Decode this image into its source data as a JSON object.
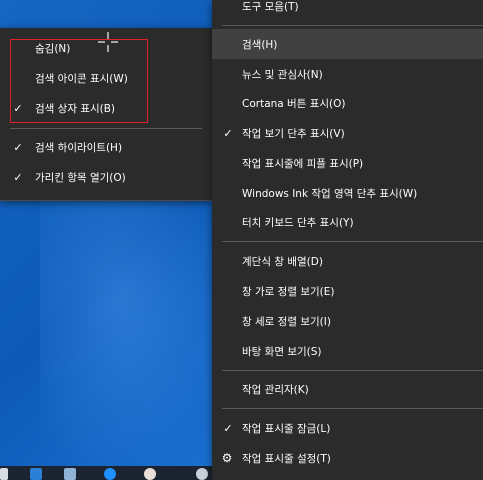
{
  "submenu": {
    "items": [
      {
        "label": "숨김(N)",
        "checked": false
      },
      {
        "label": "검색 아이콘 표시(W)",
        "checked": false
      },
      {
        "label": "검색 상자 표시(B)",
        "checked": true
      },
      {
        "label": "검색 하이라이트(H)",
        "checked": true
      },
      {
        "label": "가리킨 항목 열기(O)",
        "checked": true
      }
    ],
    "check_glyph": "✓"
  },
  "mainmenu": {
    "items": [
      {
        "label": "도구 모음(T)"
      },
      {
        "label": "검색(H)"
      },
      {
        "label": "뉴스 및 관심사(N)"
      },
      {
        "label": "Cortana 버튼 표시(O)"
      },
      {
        "label": "작업 보기 단추 표시(V)",
        "checked": true
      },
      {
        "label": "작업 표시줄에 피플 표시(P)"
      },
      {
        "label": "Windows Ink 작업 영역 단추 표시(W)"
      },
      {
        "label": "터치 키보드 단추 표시(Y)"
      },
      {
        "label": "계단식 창 배열(D)"
      },
      {
        "label": "창 가로 정렬 보기(E)"
      },
      {
        "label": "창 세로 정렬 보기(I)"
      },
      {
        "label": "바탕 화면 보기(S)"
      },
      {
        "label": "작업 관리자(K)"
      },
      {
        "label": "작업 표시줄 잠금(L)",
        "checked": true
      },
      {
        "label": "작업 표시줄 설정(T)",
        "icon": "gear-icon"
      }
    ],
    "check_glyph": "✓",
    "gear_glyph": "⚙"
  },
  "colors": {
    "menu_bg": "#2b2b2b",
    "highlight": "#414141",
    "annotation_box": "#e0202a"
  }
}
